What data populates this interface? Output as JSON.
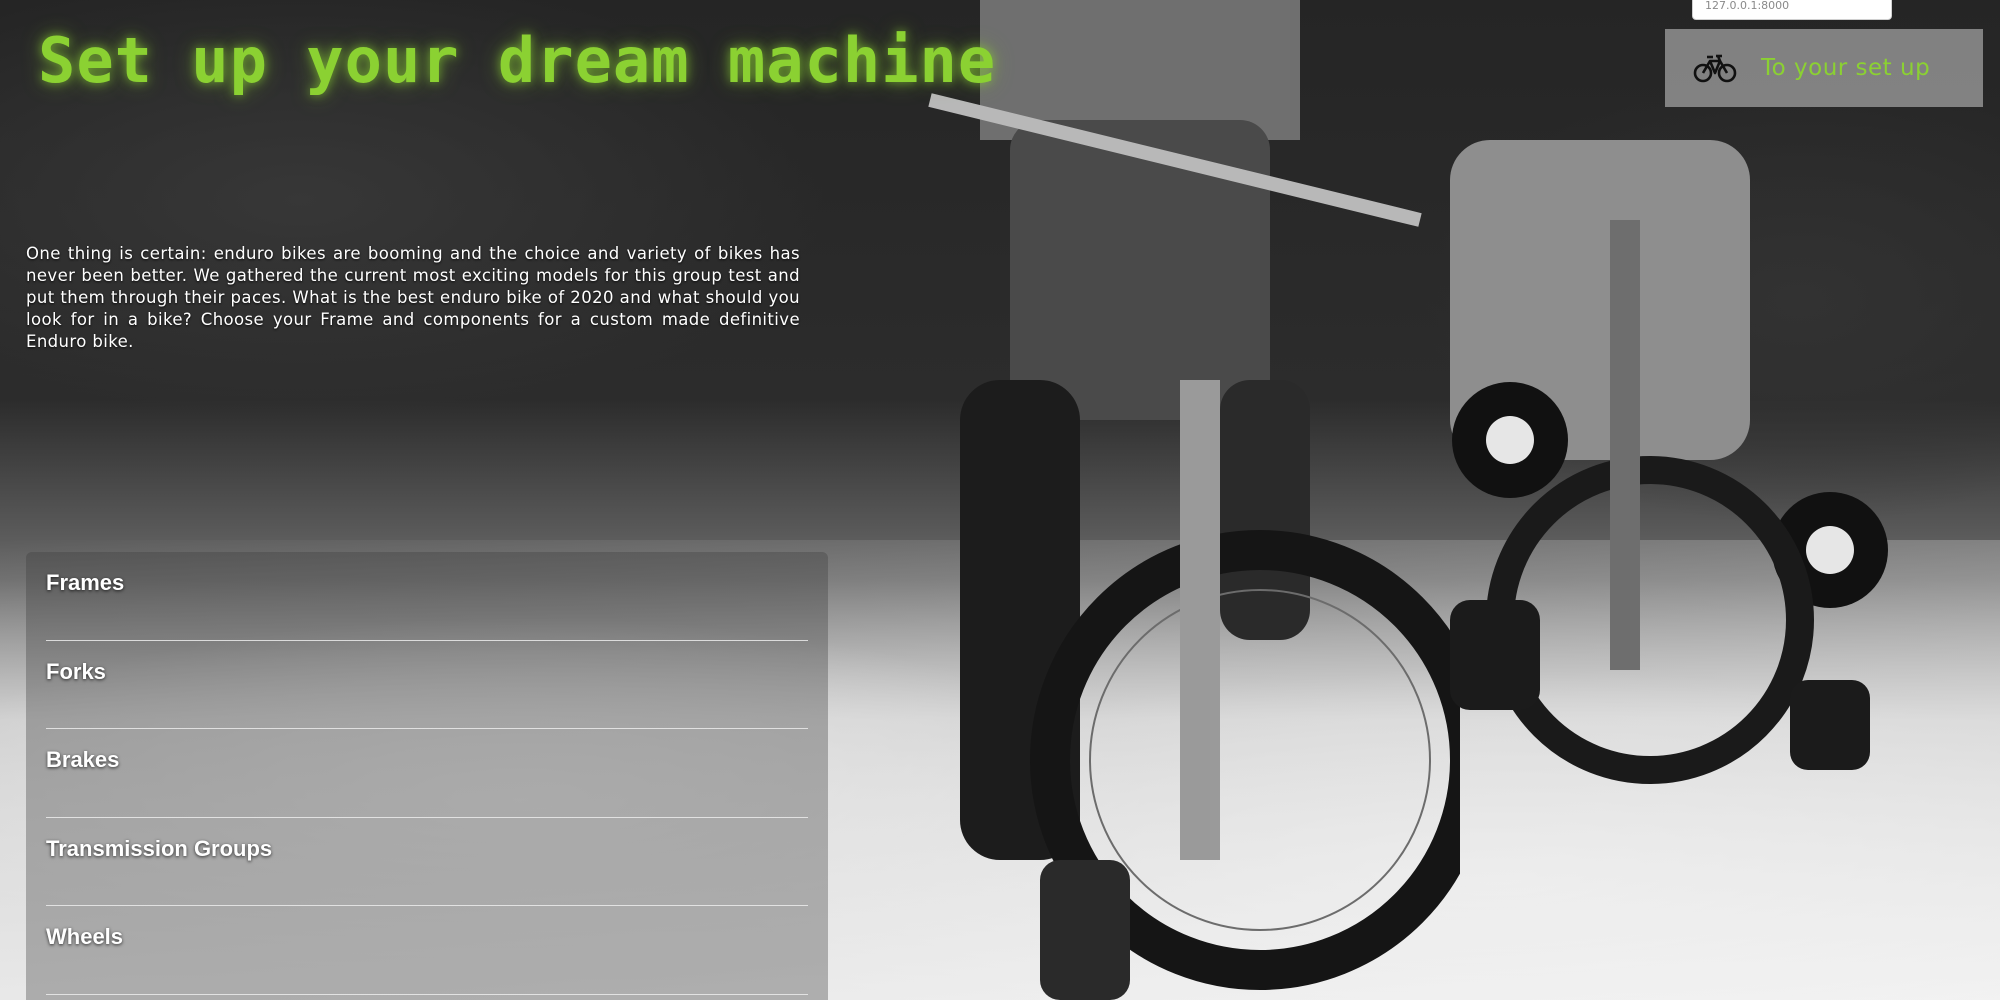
{
  "header": {
    "title": "Set up your dream machine"
  },
  "intro": {
    "text": "One thing is certain: enduro bikes are booming and the choice and variety of bikes has never been better. We gathered the current most exciting models for this group test and put them through their paces. What is the best enduro bike of 2020 and what should you look for in a bike? Choose your Frame and components for a custom made definitive Enduro bike."
  },
  "address_bar": {
    "value": "127.0.0.1:8000"
  },
  "setup_button": {
    "icon": "bicycle-icon",
    "label": "To your set up"
  },
  "categories": [
    {
      "label": "Frames"
    },
    {
      "label": "Forks"
    },
    {
      "label": "Brakes"
    },
    {
      "label": "Transmission Groups"
    },
    {
      "label": "Wheels"
    }
  ],
  "colors": {
    "accent": "#8bd132",
    "panel_background": "rgba(60,60,60,0.35)",
    "button_background": "#969696"
  }
}
